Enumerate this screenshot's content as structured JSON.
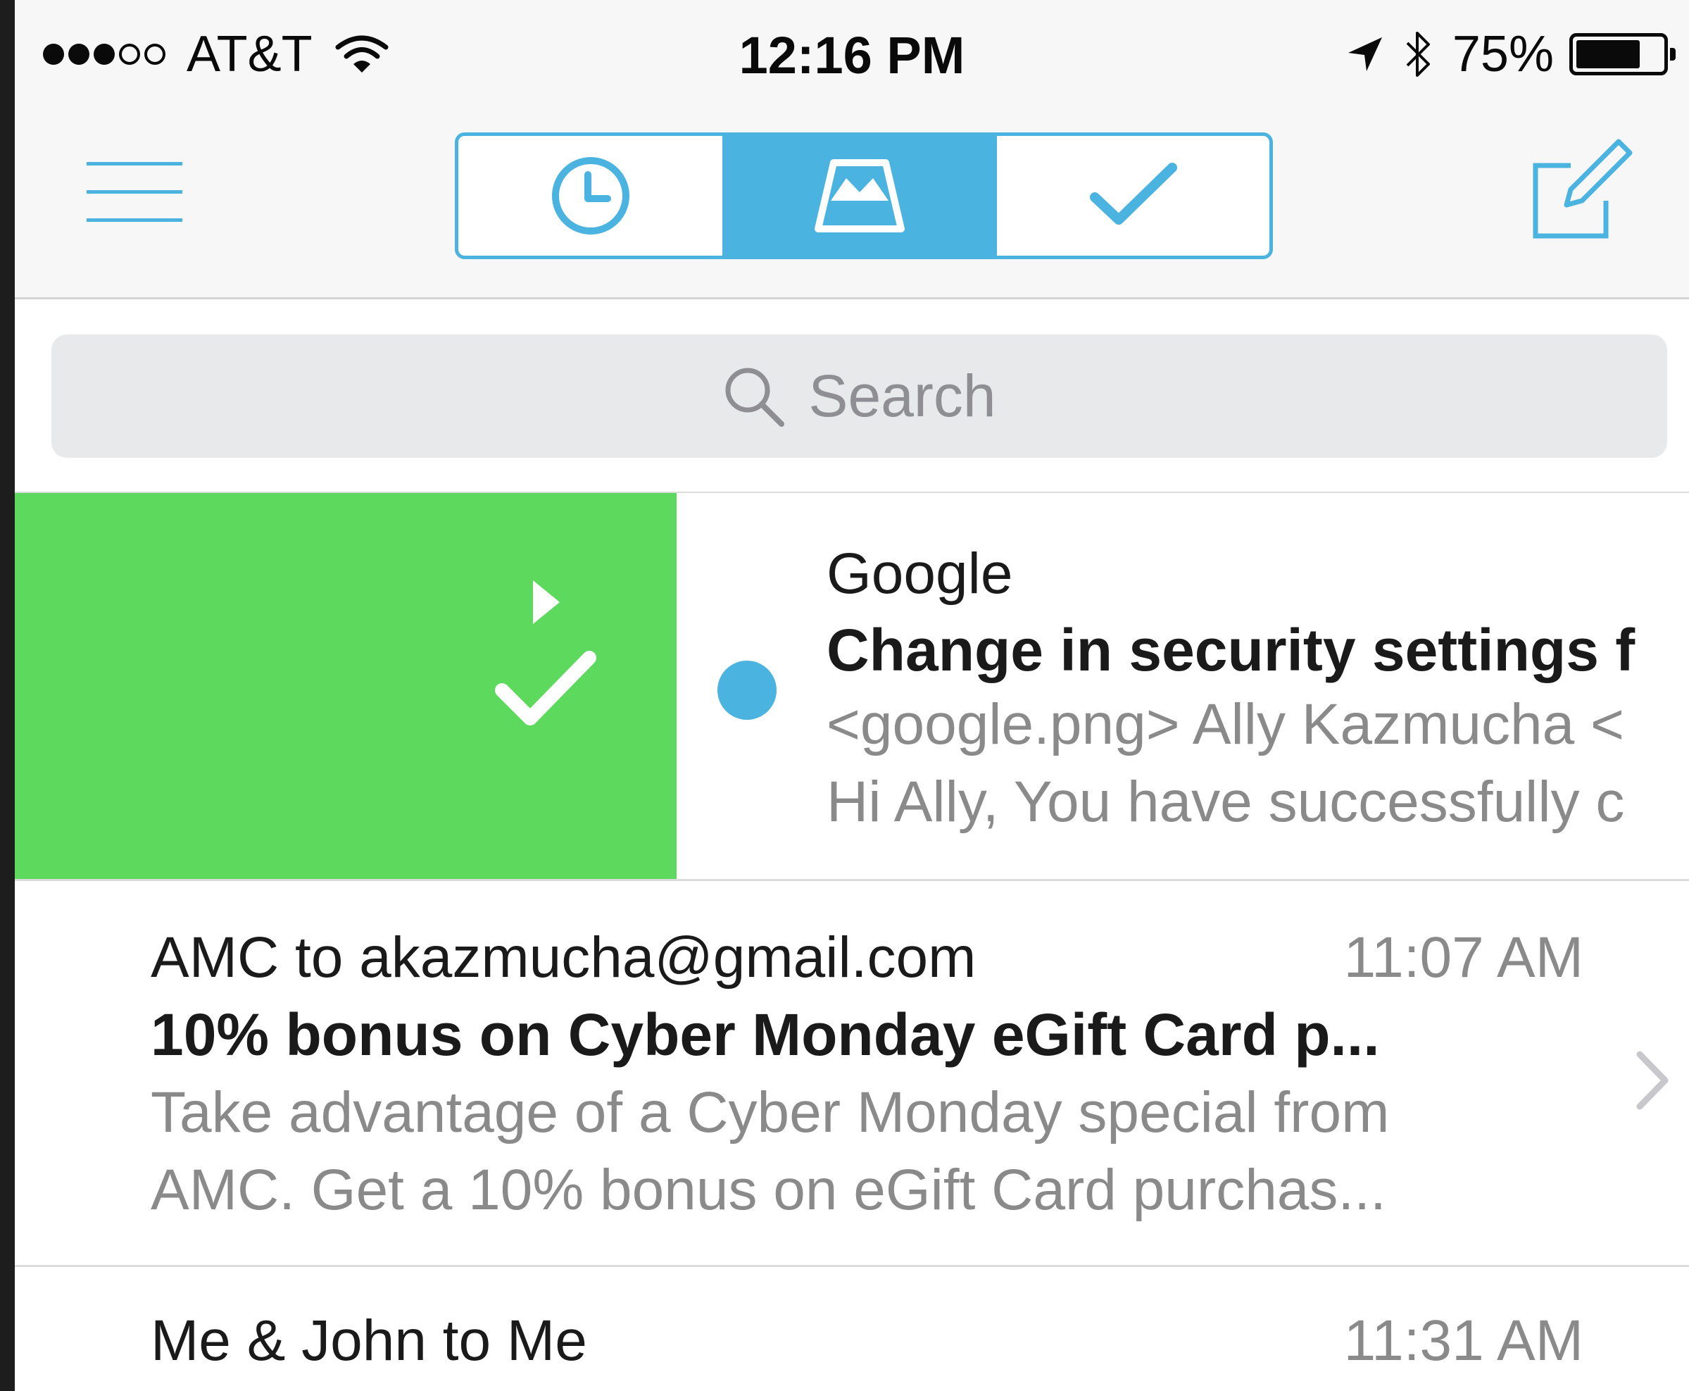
{
  "status_bar": {
    "carrier": "AT&T",
    "time": "12:16 PM",
    "battery_text": "75%",
    "battery_level": 0.75,
    "signal_bars_filled": 3,
    "signal_bars_total": 5,
    "icons": [
      "wifi-icon",
      "location-arrow-icon",
      "bluetooth-icon",
      "battery-icon"
    ]
  },
  "nav": {
    "menu_icon": "hamburger-icon",
    "segments": [
      {
        "icon": "clock-icon",
        "active": false
      },
      {
        "icon": "inbox-tray-icon",
        "active": true
      },
      {
        "icon": "checkmark-icon",
        "active": false
      }
    ],
    "compose_icon": "compose-icon"
  },
  "search": {
    "placeholder": "Search"
  },
  "emails": [
    {
      "sender": "Google",
      "subject": "Change in security settings f",
      "preview_line1": "<google.png> Ally Kazmucha <",
      "preview_line2": "Hi Ally, You have successfully c",
      "unread": true,
      "swipe_action_icons": [
        "play-arrow-icon",
        "checkmark-icon"
      ]
    },
    {
      "sender": "AMC to akazmucha@gmail.com",
      "time": "11:07 AM",
      "subject": "10% bonus on Cyber Monday eGift Card p...",
      "preview_line1": "Take advantage of a Cyber Monday special from",
      "preview_line2": "AMC. Get a 10% bonus on eGift Card purchas..."
    },
    {
      "sender": "Me & John to Me",
      "time": "11:31 AM"
    }
  ],
  "colors": {
    "accent": "#4ab3e0",
    "swipe_green": "#5dd95e",
    "search_bg": "#e8e9eb",
    "secondary_text": "#8a8a8a"
  }
}
